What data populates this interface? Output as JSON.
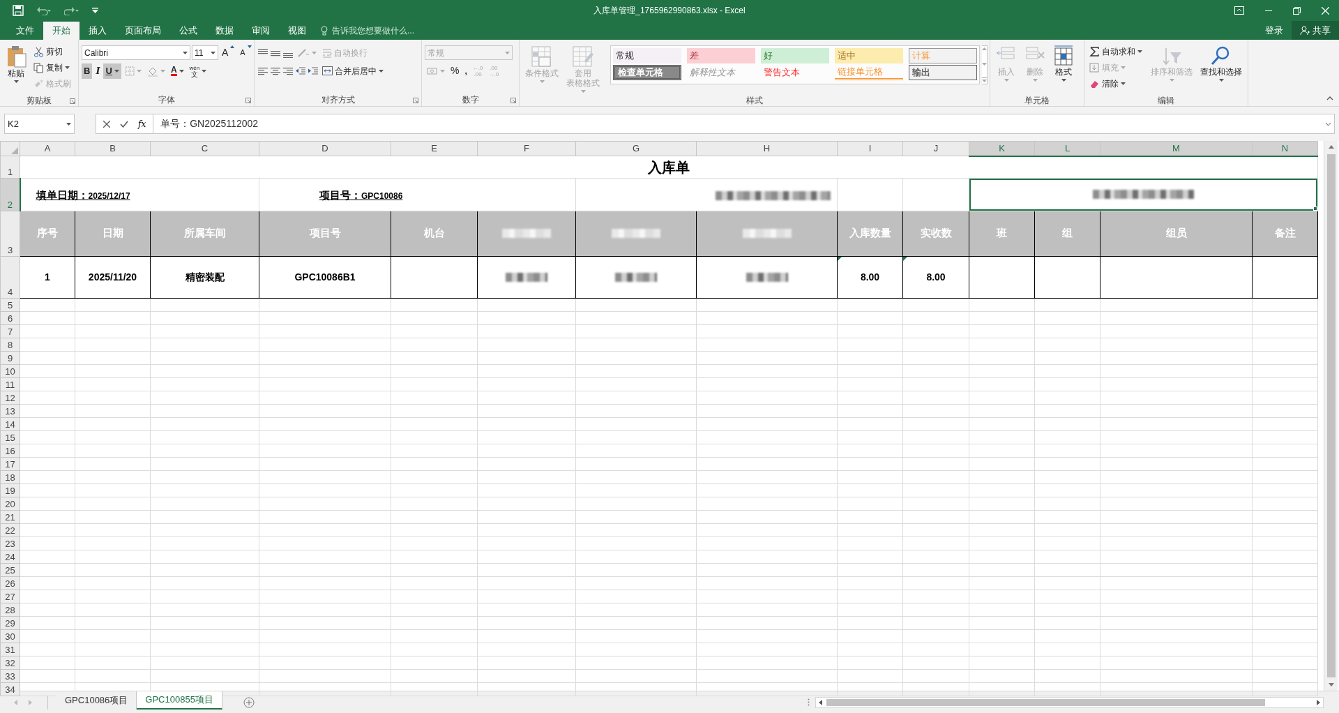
{
  "window": {
    "title": "入库单管理_1765962990863.xlsx - Excel"
  },
  "menu_tabs": [
    {
      "label": "文件",
      "selected": false
    },
    {
      "label": "开始",
      "selected": true
    },
    {
      "label": "插入",
      "selected": false
    },
    {
      "label": "页面布局",
      "selected": false
    },
    {
      "label": "公式",
      "selected": false
    },
    {
      "label": "数据",
      "selected": false
    },
    {
      "label": "审阅",
      "selected": false
    },
    {
      "label": "视图",
      "selected": false
    }
  ],
  "tell_me": {
    "placeholder": "告诉我您想要做什么..."
  },
  "account": {
    "sign_in": "登录",
    "share": "共享"
  },
  "ribbon": [
    {
      "kind": "clipboard",
      "label": "剪贴板",
      "paste": "粘贴",
      "items": [
        {
          "label": "剪切",
          "disabled": false
        },
        {
          "label": "复制",
          "disabled": false
        },
        {
          "label": "格式刷",
          "disabled": true
        }
      ]
    },
    {
      "kind": "font",
      "label": "字体",
      "font_name": "Calibri",
      "font_size": "11",
      "grow": "A",
      "shrink": "A",
      "bold": {
        "glyph": "B",
        "on": true
      },
      "italic": {
        "glyph": "I",
        "on": false
      },
      "underline": {
        "glyph": "U",
        "on": true
      },
      "font_color": "A",
      "phonetic": [
        "wén",
        "文"
      ]
    },
    {
      "kind": "alignment",
      "label": "对齐方式",
      "wrap": {
        "label": "自动换行",
        "disabled": true
      },
      "merge": {
        "label": "合并后居中",
        "disabled": false
      }
    },
    {
      "kind": "number",
      "label": "数字",
      "format": {
        "value": "常规",
        "disabled": true
      },
      "percent": "%",
      "comma": ",",
      "decimals": [
        {
          "top": "←.0",
          "bottom": ".00"
        },
        {
          "top": ".00",
          "bottom": "→.0"
        }
      ]
    },
    {
      "kind": "styles",
      "label": "样式",
      "buttons": [
        {
          "lines": [
            "条件格式"
          ],
          "disabled": true
        },
        {
          "lines": [
            "套用",
            "表格格式"
          ],
          "disabled": true
        }
      ],
      "gallery_disabled": true,
      "cell_styles": [
        {
          "label": "常规",
          "kind": "normal"
        },
        {
          "label": "差",
          "kind": "bad"
        },
        {
          "label": "好",
          "kind": "good"
        },
        {
          "label": "适中",
          "kind": "neutral"
        },
        {
          "label": "计算",
          "kind": "calculation"
        },
        {
          "label": "检查单元格",
          "kind": "check"
        },
        {
          "label": "解释性文本",
          "kind": "explanatory"
        },
        {
          "label": "警告文本",
          "kind": "warning"
        },
        {
          "label": "链接单元格",
          "kind": "linked"
        },
        {
          "label": "输出",
          "kind": "output"
        }
      ]
    },
    {
      "kind": "cells",
      "label": "单元格",
      "buttons": [
        {
          "label": "插入",
          "disabled": true
        },
        {
          "label": "删除",
          "disabled": true
        },
        {
          "label": "格式",
          "disabled": false
        }
      ]
    },
    {
      "kind": "editing",
      "label": "编辑",
      "small": [
        {
          "label": "自动求和",
          "disabled": false
        },
        {
          "label": "填充",
          "disabled": true
        },
        {
          "label": "清除",
          "disabled": false
        }
      ],
      "large": [
        {
          "label": "排序和筛选",
          "disabled": true
        },
        {
          "label": "查找和选择",
          "disabled": false
        }
      ]
    }
  ],
  "formula_bar": {
    "name_box": "K2",
    "fx": "fx",
    "formula": "单号：GN2025112002"
  },
  "sheet": {
    "columns": [
      {
        "label": "A",
        "selected": false
      },
      {
        "label": "B",
        "selected": false
      },
      {
        "label": "C",
        "selected": false
      },
      {
        "label": "D",
        "selected": false
      },
      {
        "label": "E",
        "selected": false
      },
      {
        "label": "F",
        "selected": false
      },
      {
        "label": "G",
        "selected": false
      },
      {
        "label": "H",
        "selected": false
      },
      {
        "label": "I",
        "selected": false
      },
      {
        "label": "J",
        "selected": false
      },
      {
        "label": "K",
        "selected": true
      },
      {
        "label": "L",
        "selected": true
      },
      {
        "label": "M",
        "selected": true
      },
      {
        "label": "N",
        "selected": true
      }
    ],
    "rows": [
      {
        "label": "1",
        "selected": false
      },
      {
        "label": "2",
        "selected": true
      },
      {
        "label": "3",
        "selected": false
      },
      {
        "label": "4",
        "selected": false
      },
      {
        "label": "5",
        "selected": false
      },
      {
        "label": "6",
        "selected": false
      },
      {
        "label": "7",
        "selected": false
      },
      {
        "label": "8",
        "selected": false
      },
      {
        "label": "9",
        "selected": false
      },
      {
        "label": "10",
        "selected": false
      },
      {
        "label": "11",
        "selected": false
      },
      {
        "label": "12",
        "selected": false
      },
      {
        "label": "13",
        "selected": false
      },
      {
        "label": "14",
        "selected": false
      },
      {
        "label": "15",
        "selected": false
      },
      {
        "label": "16",
        "selected": false
      },
      {
        "label": "17",
        "selected": false
      },
      {
        "label": "18",
        "selected": false
      },
      {
        "label": "19",
        "selected": false
      },
      {
        "label": "20",
        "selected": false
      },
      {
        "label": "21",
        "selected": false
      },
      {
        "label": "22",
        "selected": false
      },
      {
        "label": "23",
        "selected": false
      },
      {
        "label": "24",
        "selected": false
      },
      {
        "label": "25",
        "selected": false
      },
      {
        "label": "26",
        "selected": false
      },
      {
        "label": "27",
        "selected": false
      },
      {
        "label": "28",
        "selected": false
      },
      {
        "label": "29",
        "selected": false
      },
      {
        "label": "30",
        "selected": false
      },
      {
        "label": "31",
        "selected": false
      },
      {
        "label": "32",
        "selected": false
      },
      {
        "label": "33",
        "selected": false
      },
      {
        "label": "34",
        "selected": false
      }
    ],
    "title": "入库单",
    "fill_date": {
      "label": "填单日期：",
      "value": "2025/12/17"
    },
    "project": {
      "label": "项目号：",
      "value": "GPC10086"
    },
    "note": {
      "kind": "redacted"
    },
    "active_cell": {
      "kind": "redacted",
      "selected": true
    },
    "header": [
      {
        "kind": "text",
        "text": "序号"
      },
      {
        "kind": "text",
        "text": "日期"
      },
      {
        "kind": "text",
        "text": "所属车间"
      },
      {
        "kind": "text",
        "text": "项目号"
      },
      {
        "kind": "text",
        "text": "机台"
      },
      {
        "kind": "redacted"
      },
      {
        "kind": "redacted"
      },
      {
        "kind": "redacted"
      },
      {
        "kind": "text",
        "text": "入库数量"
      },
      {
        "kind": "text",
        "text": "实收数"
      },
      {
        "kind": "text",
        "text": "班"
      },
      {
        "kind": "text",
        "text": "组"
      },
      {
        "kind": "text",
        "text": "组员"
      },
      {
        "kind": "text",
        "text": "备注"
      }
    ],
    "records": [
      {
        "cells": [
          {
            "kind": "text",
            "text": "1",
            "flagged": false
          },
          {
            "kind": "text",
            "text": "2025/11/20",
            "flagged": false
          },
          {
            "kind": "text",
            "text": "精密装配",
            "flagged": false
          },
          {
            "kind": "text",
            "text": "GPC10086B1",
            "flagged": false
          },
          {
            "kind": "empty",
            "flagged": false
          },
          {
            "kind": "redacted",
            "flagged": false
          },
          {
            "kind": "redacted",
            "flagged": false
          },
          {
            "kind": "redacted",
            "flagged": false
          },
          {
            "kind": "text",
            "text": "8.00",
            "flagged": true
          },
          {
            "kind": "text",
            "text": "8.00",
            "flagged": true
          },
          {
            "kind": "empty",
            "flagged": false
          },
          {
            "kind": "empty",
            "flagged": false
          },
          {
            "kind": "empty",
            "flagged": false
          },
          {
            "kind": "empty",
            "flagged": false
          }
        ]
      }
    ]
  },
  "sheet_tabs": [
    {
      "label": "GPC10086项目",
      "selected": false
    },
    {
      "label": "GPC100855项目",
      "selected": true
    }
  ]
}
